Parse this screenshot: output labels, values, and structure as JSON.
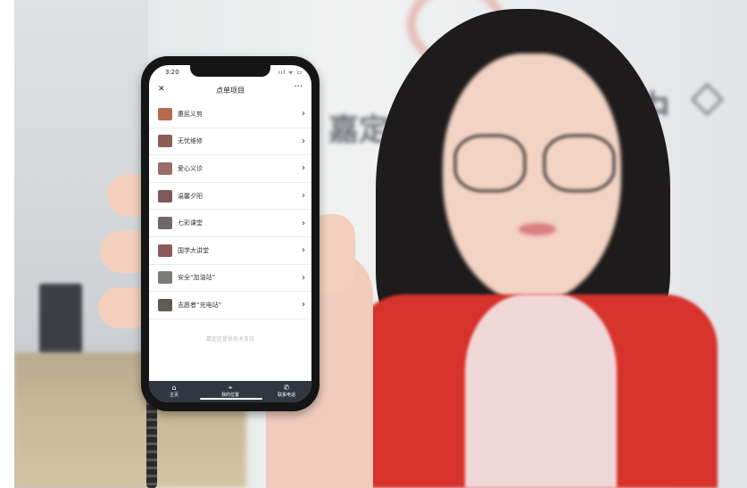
{
  "phone": {
    "status_time": "3:20",
    "status_icons": "ııl ᯤ ▭",
    "nav": {
      "close_icon": "✕",
      "title": "点单项目",
      "more_icon": "···"
    },
    "items": [
      {
        "label": "惠民义剪",
        "thumb_color": "#b56a4f"
      },
      {
        "label": "无忧维修",
        "thumb_color": "#8a5e54"
      },
      {
        "label": "爱心义诊",
        "thumb_color": "#9a6d6a"
      },
      {
        "label": "温馨夕阳",
        "thumb_color": "#7d5a58"
      },
      {
        "label": "七彩课堂",
        "thumb_color": "#6f6a6a"
      },
      {
        "label": "国学大讲堂",
        "thumb_color": "#8b5b5b"
      },
      {
        "label": "安全“加油站”",
        "thumb_color": "#7b7c78"
      },
      {
        "label": "志愿者“充电站”",
        "thumb_color": "#5f5a58"
      }
    ],
    "chevron": "›",
    "footer_note": "嘉定区提供技术支持",
    "tabs": [
      {
        "icon": "⌂",
        "label": "主页"
      },
      {
        "icon": "⌖",
        "label": "我的位置"
      },
      {
        "icon": "✆",
        "label": "联系电话"
      }
    ]
  },
  "background_signage": [
    "嘉定",
    "中",
    "◇"
  ]
}
